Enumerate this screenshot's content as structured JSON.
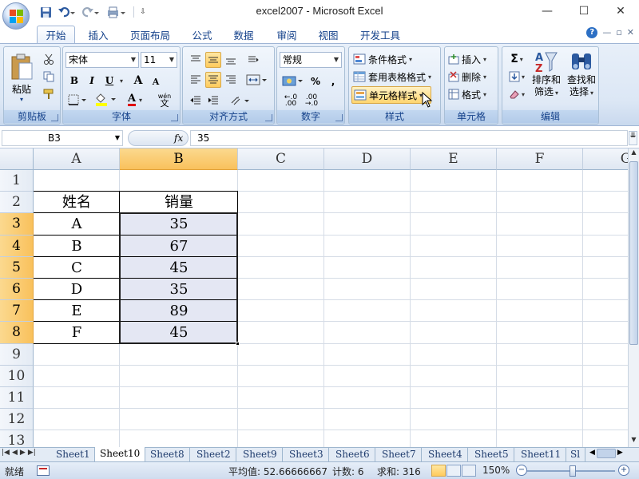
{
  "window": {
    "title": "excel2007 - Microsoft Excel",
    "minimize": "—",
    "maximize": "☐",
    "close": "✕"
  },
  "qat": {
    "save_icon": "save-icon",
    "undo_icon": "undo-icon",
    "redo_icon": "redo-icon"
  },
  "tabs": [
    {
      "label": "开始",
      "active": true
    },
    {
      "label": "插入"
    },
    {
      "label": "页面布局"
    },
    {
      "label": "公式"
    },
    {
      "label": "数据"
    },
    {
      "label": "审阅"
    },
    {
      "label": "视图"
    },
    {
      "label": "开发工具"
    }
  ],
  "ribbon": {
    "clipboard": {
      "label": "剪贴板",
      "paste": "粘贴"
    },
    "font": {
      "label": "字体",
      "font_name": "宋体",
      "font_size": "11",
      "bold": "B",
      "italic": "I",
      "underline": "U",
      "grow": "A",
      "shrink": "A",
      "font_color": "A",
      "wen": "wén",
      "wen_char": "文"
    },
    "alignment": {
      "label": "对齐方式"
    },
    "number": {
      "label": "数字",
      "format": "常规",
      "percent": "%",
      "comma": ",",
      "inc": ".0\n.00",
      "dec": ".00\n.0"
    },
    "styles": {
      "label": "样式",
      "conditional": "条件格式",
      "table": "套用表格格式",
      "cell": "单元格样式"
    },
    "cells": {
      "label": "单元格",
      "insert": "插入",
      "delete": "删除",
      "format": "格式"
    },
    "editing": {
      "label": "编辑",
      "sort": "排序和\n筛选",
      "find": "查找和\n选择",
      "sort_l1": "排序和",
      "sort_l2": "筛选",
      "find_l1": "查找和",
      "find_l2": "选择"
    }
  },
  "formula_bar": {
    "name_box": "B3",
    "fx": "fx",
    "formula": "35"
  },
  "grid": {
    "columns": [
      "A",
      "B",
      "C",
      "D",
      "E",
      "F",
      "G"
    ],
    "rows": [
      "1",
      "2",
      "3",
      "4",
      "5",
      "6",
      "7",
      "8",
      "9",
      "10",
      "11",
      "12",
      "13"
    ],
    "header_row": {
      "A": "姓名",
      "B": "销量"
    },
    "data": [
      {
        "name": "A",
        "sales": "35"
      },
      {
        "name": "B",
        "sales": "67"
      },
      {
        "name": "C",
        "sales": "45"
      },
      {
        "name": "D",
        "sales": "35"
      },
      {
        "name": "E",
        "sales": "89"
      },
      {
        "name": "F",
        "sales": "45"
      }
    ],
    "selected_range": "B3:B8"
  },
  "sheets": [
    "Sheet1",
    "Sheet10",
    "Sheet8",
    "Sheet2",
    "Sheet9",
    "Sheet3",
    "Sheet6",
    "Sheet7",
    "Sheet4",
    "Sheet5",
    "Sheet11",
    "Sl"
  ],
  "active_sheet": "Sheet10",
  "status": {
    "ready": "就绪",
    "average": "平均值: 52.66666667",
    "count": "计数: 6",
    "sum": "求和: 316",
    "zoom": "150%",
    "minus": "−",
    "plus": "+"
  },
  "colors": {
    "ribbon_bg": "#dce7f5",
    "selected_header": "#f9c15c",
    "selection_fill": "#e4e7f3",
    "accent": "#15428b"
  }
}
